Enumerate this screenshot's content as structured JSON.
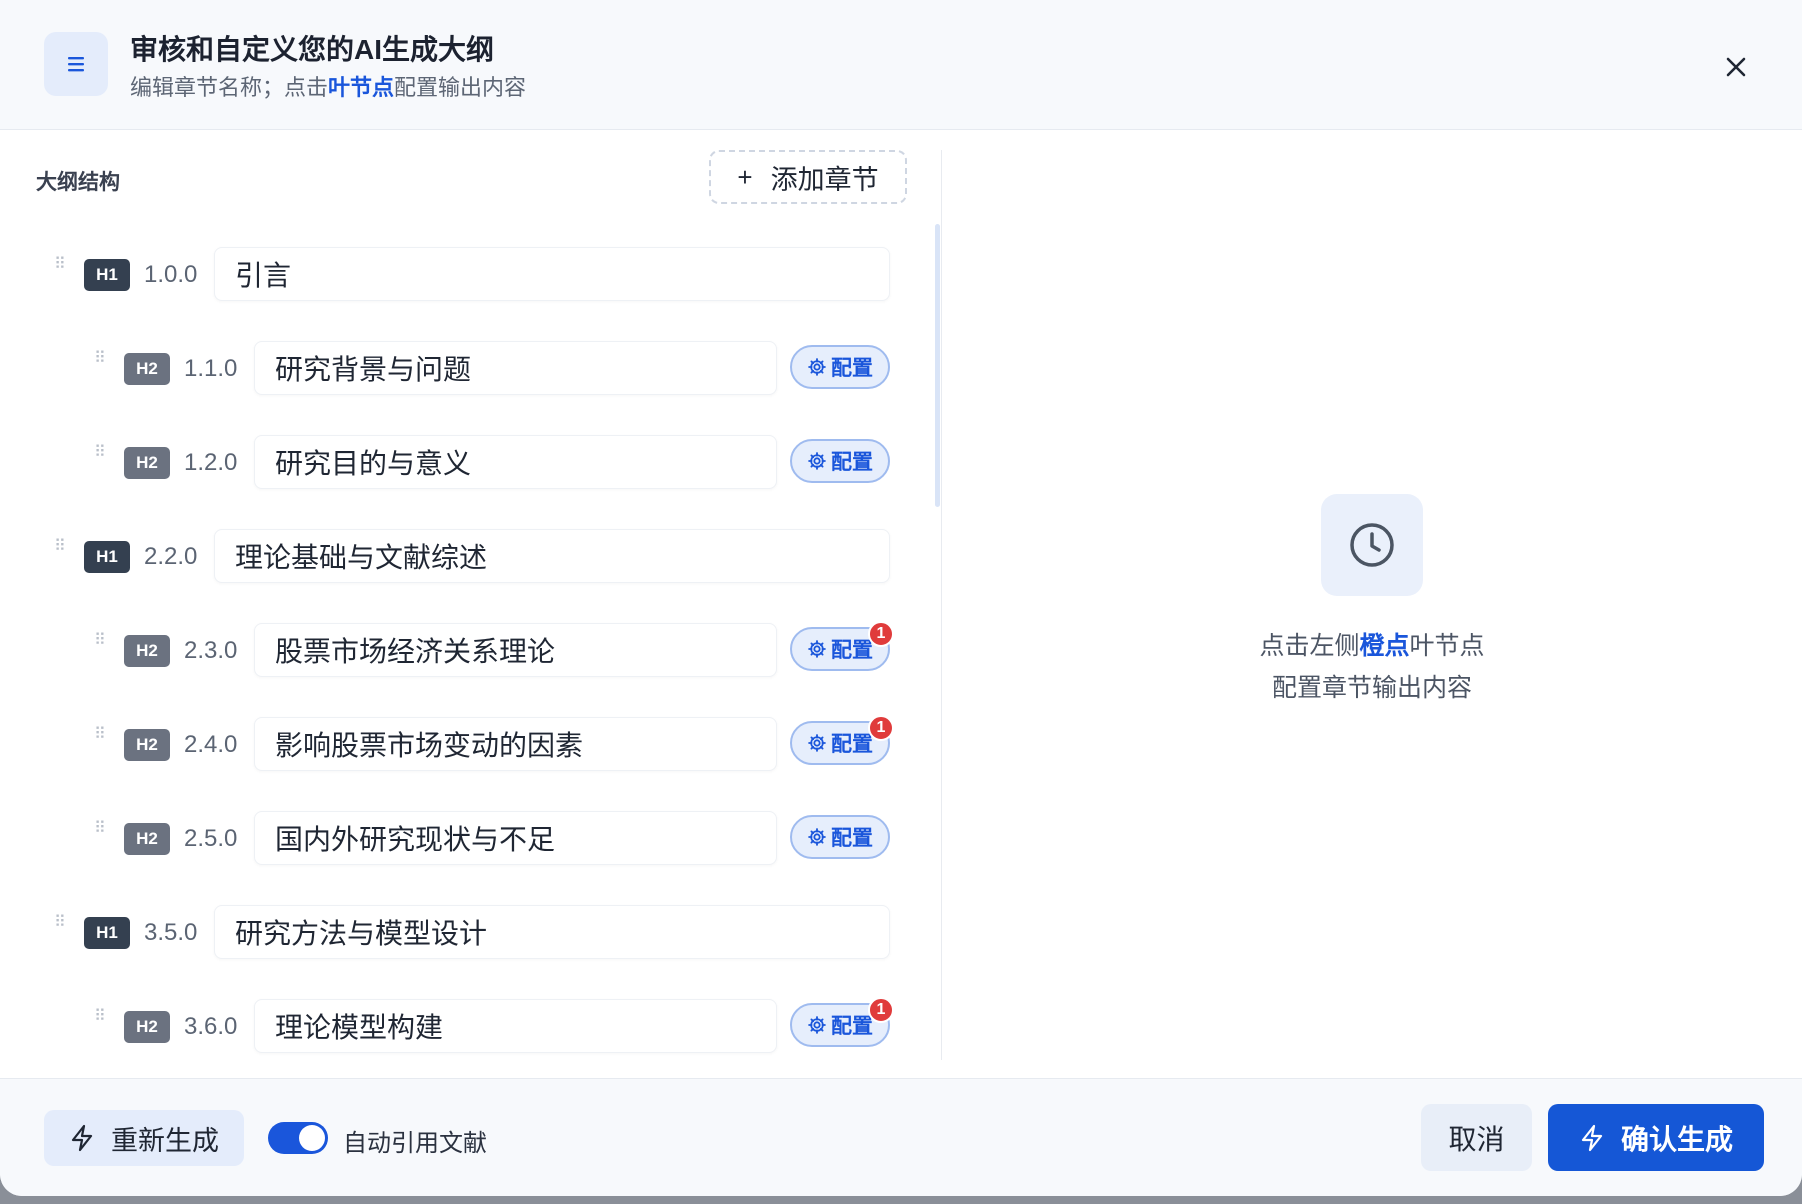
{
  "header": {
    "title": "审核和自定义您的AI生成大纲",
    "subtitle_pre": "编辑章节名称；点击",
    "subtitle_highlight": "叶节点",
    "subtitle_post": "配置输出内容",
    "icon": "list-icon",
    "close_icon": "close-icon"
  },
  "outline": {
    "label": "大纲结构",
    "add_button_label": "添加章节",
    "config_label": "配置",
    "items": [
      {
        "level": "H1",
        "number": "1.0.0",
        "title": "引言",
        "has_config": false,
        "badge": ""
      },
      {
        "level": "H2",
        "number": "1.1.0",
        "title": "研究背景与问题",
        "has_config": true,
        "badge": ""
      },
      {
        "level": "H2",
        "number": "1.2.0",
        "title": "研究目的与意义",
        "has_config": true,
        "badge": ""
      },
      {
        "level": "H1",
        "number": "2.2.0",
        "title": "理论基础与文献综述",
        "has_config": false,
        "badge": ""
      },
      {
        "level": "H2",
        "number": "2.3.0",
        "title": "股票市场经济关系理论",
        "has_config": true,
        "badge": "1"
      },
      {
        "level": "H2",
        "number": "2.4.0",
        "title": "影响股票市场变动的因素",
        "has_config": true,
        "badge": "1"
      },
      {
        "level": "H2",
        "number": "2.5.0",
        "title": "国内外研究现状与不足",
        "has_config": true,
        "badge": ""
      },
      {
        "level": "H1",
        "number": "3.5.0",
        "title": "研究方法与模型设计",
        "has_config": false,
        "badge": ""
      },
      {
        "level": "H2",
        "number": "3.6.0",
        "title": "理论模型构建",
        "has_config": true,
        "badge": "1"
      }
    ]
  },
  "placeholder": {
    "icon": "clock-icon",
    "line1_pre": "点击左侧",
    "line1_highlight": "橙点",
    "line1_post": "叶节点",
    "line2": "配置章节输出内容"
  },
  "footer": {
    "regenerate_label": "重新生成",
    "auto_cite_label": "自动引用文献",
    "auto_cite_enabled": true,
    "cancel_label": "取消",
    "confirm_label": "确认生成"
  },
  "colors": {
    "accent": "#1a56db",
    "badge": "#e03b3b",
    "h1_tag": "#344050",
    "h2_tag": "#6b7280"
  }
}
